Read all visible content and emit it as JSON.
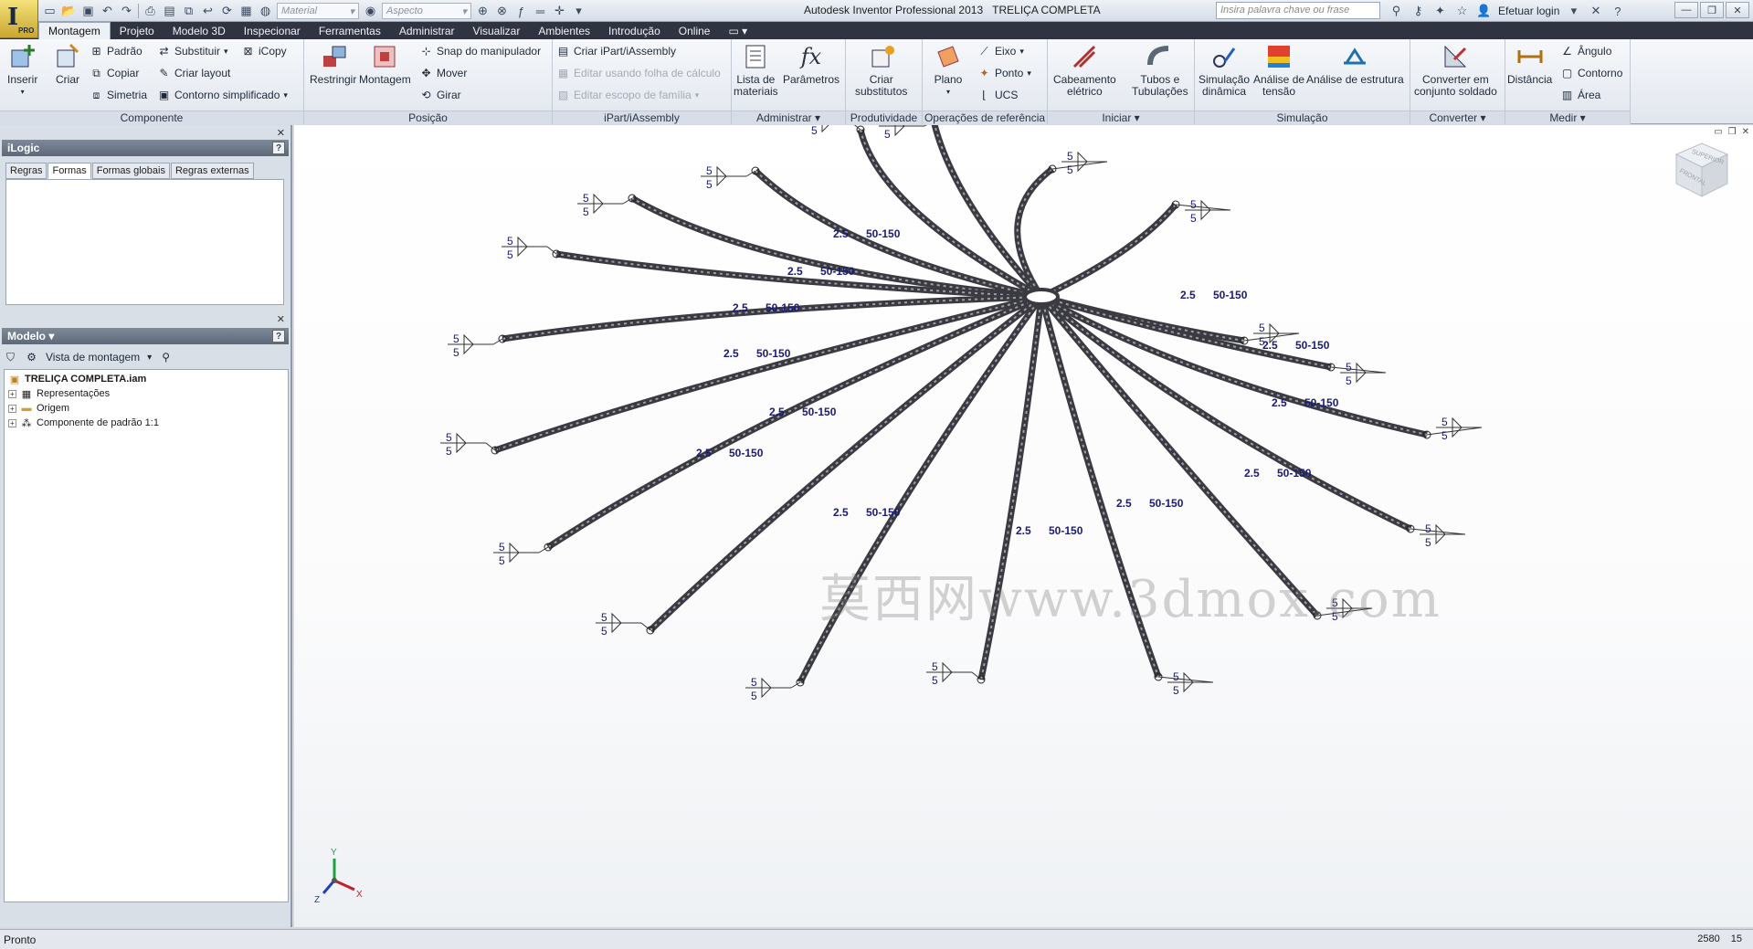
{
  "app": {
    "title": "Autodesk Inventor Professional 2013",
    "document": "TRELIÇA COMPLETA",
    "logo_letter": "I",
    "logo_badge": "PRO"
  },
  "quick_access": {
    "material_placeholder": "Material",
    "appearance_placeholder": "Aspecto"
  },
  "search": {
    "placeholder": "Insira palavra chave ou frase"
  },
  "login_label": "Efetuar login",
  "ribbon_tabs": [
    "Montagem",
    "Projeto",
    "Modelo 3D",
    "Inspecionar",
    "Ferramentas",
    "Administrar",
    "Visualizar",
    "Ambientes",
    "Introdução",
    "Online"
  ],
  "ribbon": {
    "componente": {
      "title": "Componente",
      "inserir": "Inserir",
      "criar": "Criar",
      "padrao": "Padrão",
      "copiar": "Copiar",
      "simetria": "Simetria",
      "substituir": "Substituir",
      "criar_layout": "Criar layout",
      "contorno_simplificado": "Contorno simplificado",
      "icopy": "iCopy"
    },
    "posicao": {
      "title": "Posição",
      "restringir": "Restringir",
      "montagem": "Montagem",
      "snap": "Snap do manipulador",
      "mover": "Mover",
      "girar": "Girar"
    },
    "ipart": {
      "title": "iPart/iAssembly",
      "criar": "Criar iPart/iAssembly",
      "editar_folha": "Editar usando folha de cálculo",
      "editar_escopo": "Editar escopo de família"
    },
    "administrar": {
      "title": "Administrar",
      "lista_l1": "Lista de",
      "lista_l2": "materiais",
      "parametros": "Parâmetros"
    },
    "produtividade": {
      "title": "Produtividade",
      "criar_l1": "Criar",
      "criar_l2": "substitutos"
    },
    "operacoes": {
      "title": "Operações de referência",
      "plano": "Plano",
      "eixo": "Eixo",
      "ponto": "Ponto",
      "ucs": "UCS"
    },
    "iniciar": {
      "title": "Iniciar",
      "cabeamento_l1": "Cabeamento",
      "cabeamento_l2": "elétrico",
      "tubos_l1": "Tubos e",
      "tubos_l2": "Tubulações"
    },
    "simulacao": {
      "title": "Simulação",
      "dinamica_l1": "Simulação",
      "dinamica_l2": "dinâmica",
      "tensao_l1": "Análise de",
      "tensao_l2": "tensão",
      "estrutura": "Análise de estrutura"
    },
    "converter": {
      "title": "Converter",
      "conv_l1": "Converter em",
      "conv_l2": "conjunto soldado"
    },
    "medir": {
      "title": "Medir",
      "distancia": "Distância",
      "angulo": "Ângulo",
      "contorno": "Contorno",
      "area": "Área"
    }
  },
  "ilogic": {
    "title": "iLogic",
    "tabs": [
      "Regras",
      "Formas",
      "Formas globais",
      "Regras externas"
    ],
    "active_tab": "Formas"
  },
  "model": {
    "title": "Modelo",
    "view": "Vista de montagem",
    "tree": [
      {
        "label": "TRELIÇA COMPLETA.iam",
        "level": 0,
        "icon": "assembly-icon"
      },
      {
        "label": "Representações",
        "level": 1,
        "icon": "representations-icon"
      },
      {
        "label": "Origem",
        "level": 1,
        "icon": "folder-icon"
      },
      {
        "label": "Componente de padrão 1:1",
        "level": 1,
        "icon": "pattern-icon"
      }
    ]
  },
  "viewport": {
    "watermark": "莫西网www.3dmox.com",
    "viewcube_top": "SUPERIOR",
    "viewcube_front": "FRONTAL",
    "weld_labels": {
      "leg": "5",
      "small": "2.5",
      "pitch": "50-150"
    },
    "axis": {
      "x": "X",
      "y": "Y",
      "z": "Z"
    }
  },
  "status": {
    "text": "Pronto",
    "count_a": "2580",
    "count_b": "15"
  },
  "colors": {
    "tab_bar": "#2f3440",
    "truss": "#3a3a40",
    "weld_symbol": "#1a1a7a",
    "axis_x": "#c0202a",
    "axis_y": "#22a040",
    "axis_z": "#2040c0"
  }
}
